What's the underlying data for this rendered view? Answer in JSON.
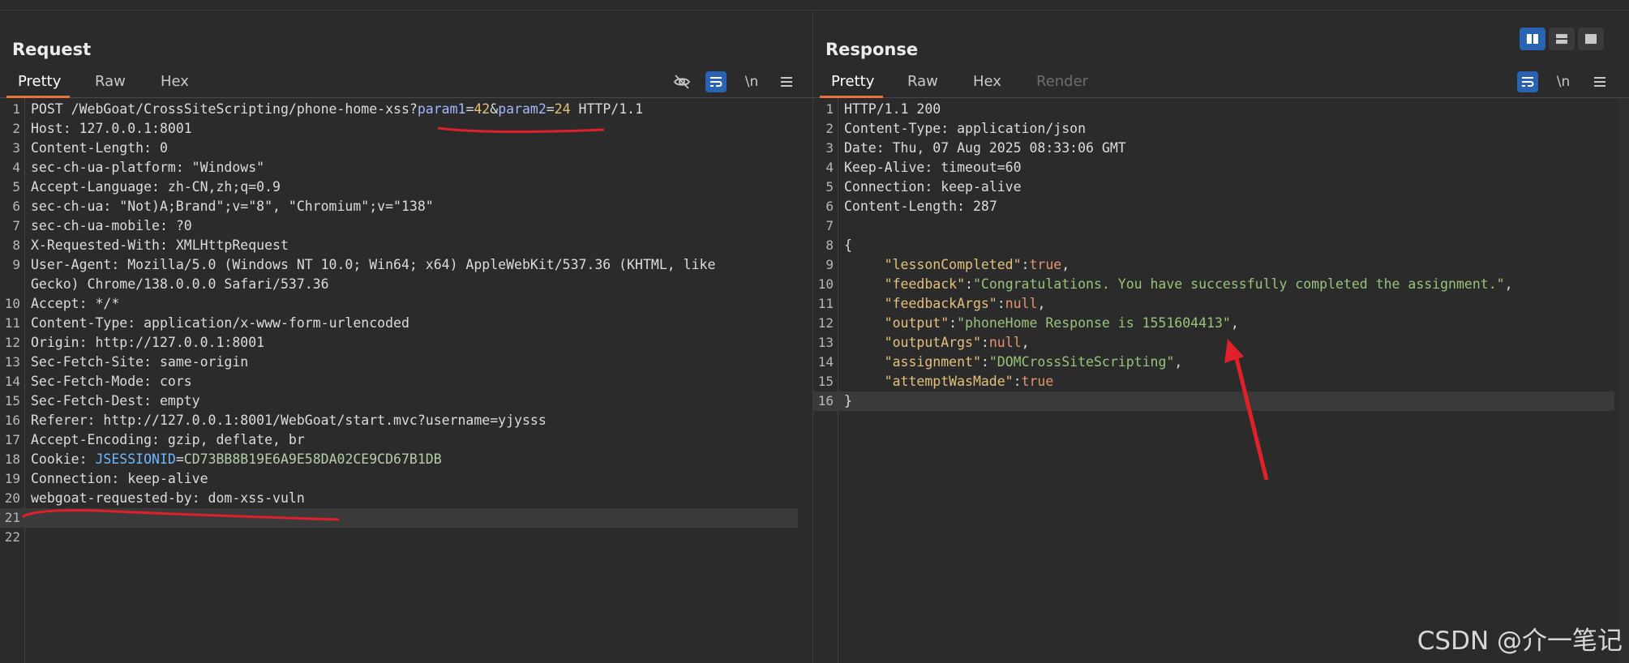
{
  "request": {
    "title": "Request",
    "tabs": [
      {
        "label": "Pretty"
      },
      {
        "label": "Raw"
      },
      {
        "label": "Hex"
      }
    ],
    "icons": [
      "eye-off-icon",
      "wrap-lines-icon",
      "newline-icon",
      "menu-icon"
    ],
    "newline_label": "\\n",
    "lines": [
      {
        "n": "1",
        "parts": [
          {
            "t": "POST /WebGoat/CrossSiteScripting/phone-home-xss?",
            "c": "k"
          },
          {
            "t": "param1",
            "c": "pn"
          },
          {
            "t": "=",
            "c": "v"
          },
          {
            "t": "42",
            "c": "pv"
          },
          {
            "t": "&",
            "c": "v"
          },
          {
            "t": "param2",
            "c": "pn"
          },
          {
            "t": "=",
            "c": "v"
          },
          {
            "t": "24",
            "c": "pv"
          },
          {
            "t": " HTTP/1.1",
            "c": "v"
          }
        ]
      },
      {
        "n": "2",
        "parts": [
          {
            "t": "Host",
            "c": "k"
          },
          {
            "t": ": 127.0.0.1:8001",
            "c": "v"
          }
        ]
      },
      {
        "n": "3",
        "parts": [
          {
            "t": "Content-Length",
            "c": "k"
          },
          {
            "t": ": 0",
            "c": "v"
          }
        ]
      },
      {
        "n": "4",
        "parts": [
          {
            "t": "sec-ch-ua-platform",
            "c": "k"
          },
          {
            "t": ": \"Windows\"",
            "c": "v"
          }
        ]
      },
      {
        "n": "5",
        "parts": [
          {
            "t": "Accept-Language",
            "c": "k"
          },
          {
            "t": ": zh-CN,zh;q=0.9",
            "c": "v"
          }
        ]
      },
      {
        "n": "6",
        "parts": [
          {
            "t": "sec-ch-ua",
            "c": "k"
          },
          {
            "t": ": \"Not)A;Brand\";v=\"8\", \"Chromium\";v=\"138\"",
            "c": "v"
          }
        ]
      },
      {
        "n": "7",
        "parts": [
          {
            "t": "sec-ch-ua-mobile",
            "c": "k"
          },
          {
            "t": ": ?0",
            "c": "v"
          }
        ]
      },
      {
        "n": "8",
        "parts": [
          {
            "t": "X-Requested-With",
            "c": "k"
          },
          {
            "t": ": XMLHttpRequest",
            "c": "v"
          }
        ]
      },
      {
        "n": "9",
        "parts": [
          {
            "t": "User-Agent",
            "c": "k"
          },
          {
            "t": ": Mozilla/5.0 (Windows NT 10.0; Win64; x64) AppleWebKit/537.36 (KHTML, like",
            "c": "v"
          }
        ]
      },
      {
        "n": "",
        "parts": [
          {
            "t": "Gecko) Chrome/138.0.0.0 Safari/537.36",
            "c": "v"
          }
        ]
      },
      {
        "n": "10",
        "parts": [
          {
            "t": "Accept",
            "c": "k"
          },
          {
            "t": ": */*",
            "c": "v"
          }
        ]
      },
      {
        "n": "11",
        "parts": [
          {
            "t": "Content-Type",
            "c": "k"
          },
          {
            "t": ": application/x-www-form-urlencoded",
            "c": "v"
          }
        ]
      },
      {
        "n": "12",
        "parts": [
          {
            "t": "Origin",
            "c": "k"
          },
          {
            "t": ": http://127.0.0.1:8001",
            "c": "v"
          }
        ]
      },
      {
        "n": "13",
        "parts": [
          {
            "t": "Sec-Fetch-Site",
            "c": "k"
          },
          {
            "t": ": same-origin",
            "c": "v"
          }
        ]
      },
      {
        "n": "14",
        "parts": [
          {
            "t": "Sec-Fetch-Mode",
            "c": "k"
          },
          {
            "t": ": cors",
            "c": "v"
          }
        ]
      },
      {
        "n": "15",
        "parts": [
          {
            "t": "Sec-Fetch-Dest",
            "c": "k"
          },
          {
            "t": ": empty",
            "c": "v"
          }
        ]
      },
      {
        "n": "16",
        "parts": [
          {
            "t": "Referer",
            "c": "k"
          },
          {
            "t": ": http://127.0.0.1:8001/WebGoat/start.mvc?username=yjysss",
            "c": "v"
          }
        ]
      },
      {
        "n": "17",
        "parts": [
          {
            "t": "Accept-Encoding",
            "c": "k"
          },
          {
            "t": ": gzip, deflate, br",
            "c": "v"
          }
        ]
      },
      {
        "n": "18",
        "parts": [
          {
            "t": "Cookie",
            "c": "k"
          },
          {
            "t": ": ",
            "c": "v"
          },
          {
            "t": "JSESSIONID",
            "c": "ck"
          },
          {
            "t": "=",
            "c": "v"
          },
          {
            "t": "CD73BB8B19E6A9E58DA02CE9CD67B1DB",
            "c": "cv"
          }
        ]
      },
      {
        "n": "19",
        "parts": [
          {
            "t": "Connection",
            "c": "k"
          },
          {
            "t": ": keep-alive",
            "c": "v"
          }
        ]
      },
      {
        "n": "20",
        "parts": [
          {
            "t": "webgoat-requested-by",
            "c": "k"
          },
          {
            "t": ": dom-xss-vuln",
            "c": "v"
          }
        ]
      },
      {
        "n": "21",
        "parts": [],
        "hl": true
      },
      {
        "n": "22",
        "parts": []
      }
    ]
  },
  "response": {
    "title": "Response",
    "tabs": [
      {
        "label": "Pretty"
      },
      {
        "label": "Raw"
      },
      {
        "label": "Hex"
      },
      {
        "label": "Render"
      }
    ],
    "icons": [
      "wrap-lines-icon",
      "newline-icon",
      "menu-icon"
    ],
    "newline_label": "\\n",
    "lines": [
      {
        "n": "1",
        "parts": [
          {
            "t": "HTTP/1.1 200",
            "c": "k"
          }
        ]
      },
      {
        "n": "2",
        "parts": [
          {
            "t": "Content-Type",
            "c": "k"
          },
          {
            "t": ": application/json",
            "c": "v"
          }
        ]
      },
      {
        "n": "3",
        "parts": [
          {
            "t": "Date",
            "c": "k"
          },
          {
            "t": ": Thu, 07 Aug 2025 08:33:06 GMT",
            "c": "v"
          }
        ]
      },
      {
        "n": "4",
        "parts": [
          {
            "t": "Keep-Alive",
            "c": "k"
          },
          {
            "t": ": timeout=60",
            "c": "v"
          }
        ]
      },
      {
        "n": "5",
        "parts": [
          {
            "t": "Connection",
            "c": "k"
          },
          {
            "t": ": keep-alive",
            "c": "v"
          }
        ]
      },
      {
        "n": "6",
        "parts": [
          {
            "t": "Content-Length",
            "c": "k"
          },
          {
            "t": ": 287",
            "c": "v"
          }
        ]
      },
      {
        "n": "7",
        "parts": []
      },
      {
        "n": "8",
        "parts": [
          {
            "t": "{",
            "c": "v"
          }
        ]
      },
      {
        "n": "9",
        "parts": [
          {
            "t": "     \"lessonCompleted\"",
            "c": "jk"
          },
          {
            "t": ":",
            "c": "v"
          },
          {
            "t": "true",
            "c": "jb"
          },
          {
            "t": ",",
            "c": "v"
          }
        ]
      },
      {
        "n": "10",
        "parts": [
          {
            "t": "     \"feedback\"",
            "c": "jk"
          },
          {
            "t": ":",
            "c": "v"
          },
          {
            "t": "\"Congratulations. You have successfully completed the assignment.\"",
            "c": "js"
          },
          {
            "t": ",",
            "c": "v"
          }
        ]
      },
      {
        "n": "11",
        "parts": [
          {
            "t": "     \"feedbackArgs\"",
            "c": "jk"
          },
          {
            "t": ":",
            "c": "v"
          },
          {
            "t": "null",
            "c": "jb"
          },
          {
            "t": ",",
            "c": "v"
          }
        ]
      },
      {
        "n": "12",
        "parts": [
          {
            "t": "     \"output\"",
            "c": "jk"
          },
          {
            "t": ":",
            "c": "v"
          },
          {
            "t": "\"phoneHome Response is 1551604413\"",
            "c": "js"
          },
          {
            "t": ",",
            "c": "v"
          }
        ]
      },
      {
        "n": "13",
        "parts": [
          {
            "t": "     \"outputArgs\"",
            "c": "jk"
          },
          {
            "t": ":",
            "c": "v"
          },
          {
            "t": "null",
            "c": "jb"
          },
          {
            "t": ",",
            "c": "v"
          }
        ]
      },
      {
        "n": "14",
        "parts": [
          {
            "t": "     \"assignment\"",
            "c": "jk"
          },
          {
            "t": ":",
            "c": "v"
          },
          {
            "t": "\"DOMCrossSiteScripting\"",
            "c": "js"
          },
          {
            "t": ",",
            "c": "v"
          }
        ]
      },
      {
        "n": "15",
        "parts": [
          {
            "t": "     \"attemptWasMade\"",
            "c": "jk"
          },
          {
            "t": ":",
            "c": "v"
          },
          {
            "t": "true",
            "c": "jb"
          }
        ]
      },
      {
        "n": "16",
        "parts": [
          {
            "t": "}",
            "c": "v"
          }
        ],
        "hl": true
      }
    ]
  },
  "view_toggles": [
    "split-horizontal-icon",
    "split-vertical-icon",
    "single-pane-icon"
  ],
  "watermark": "CSDN @介一笔记",
  "colors": {
    "accent": "#e8743b",
    "toggle_active": "#2b63b3",
    "annotation": "#e0202a"
  }
}
